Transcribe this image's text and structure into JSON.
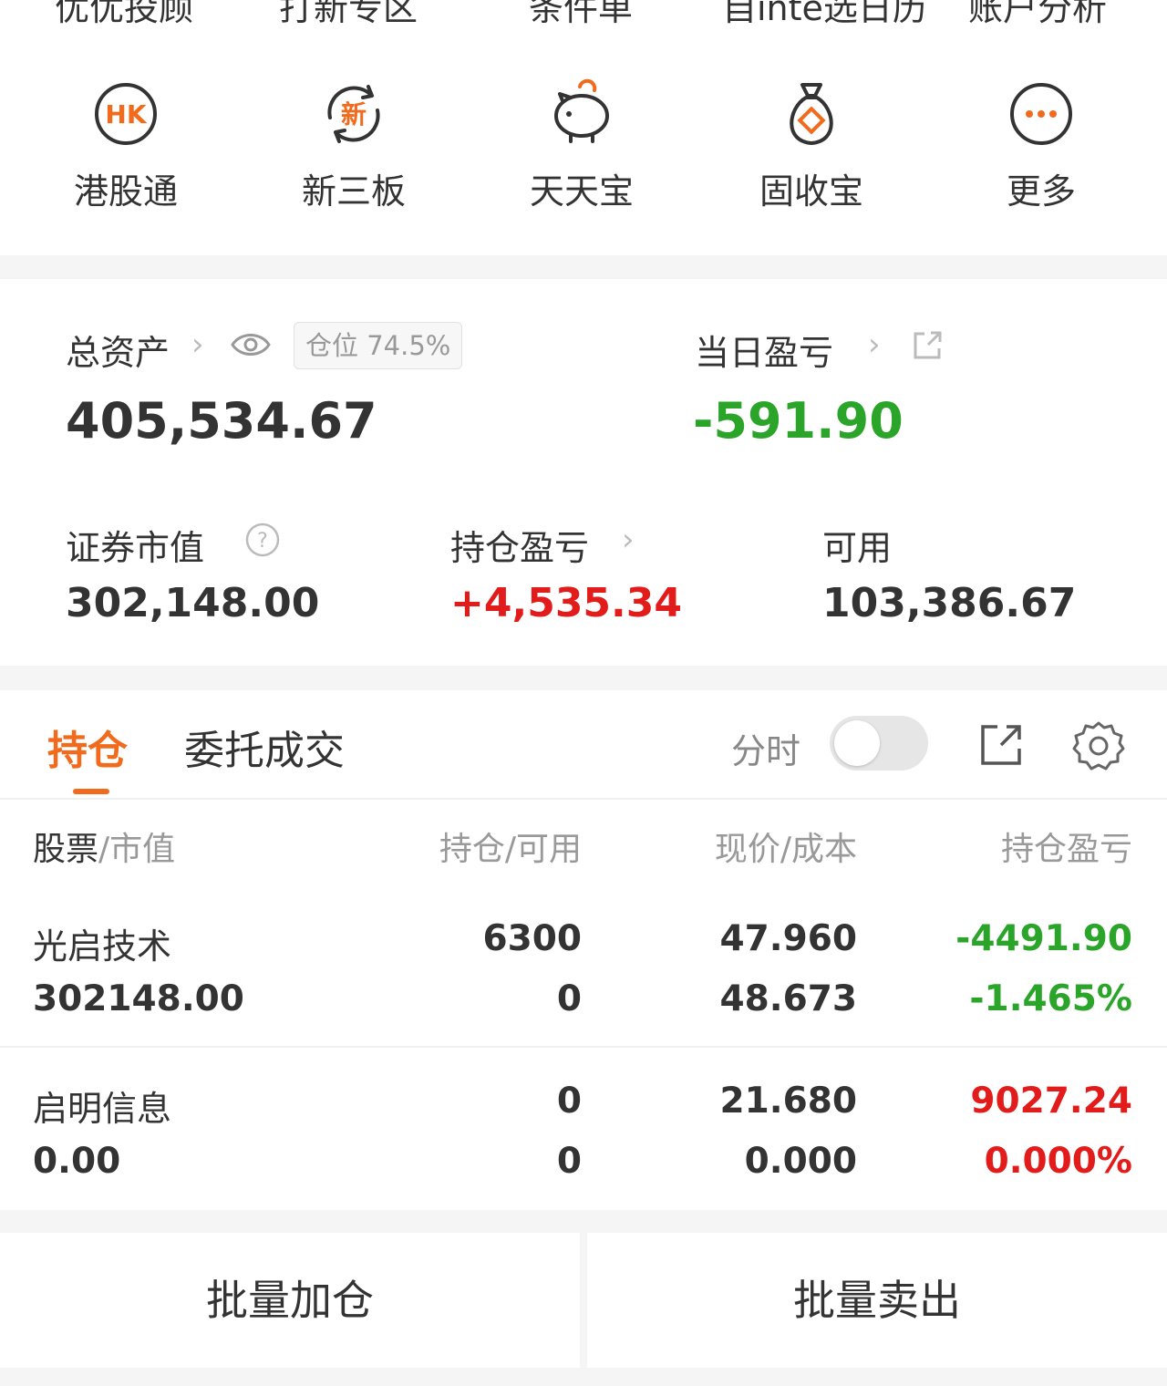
{
  "top_nav": {
    "cut_labels": [
      "优优投顾",
      "打新专区",
      "条件单",
      "自inte选日历",
      "账户分析"
    ],
    "items": [
      {
        "label": "港股通",
        "icon": "hk-icon",
        "icon_text": "HK"
      },
      {
        "label": "新三板",
        "icon": "new-board-icon",
        "icon_text": "新"
      },
      {
        "label": "天天宝",
        "icon": "piggy-bank-icon"
      },
      {
        "label": "固收宝",
        "icon": "money-bag-icon"
      },
      {
        "label": "更多",
        "icon": "more-icon"
      }
    ]
  },
  "summary": {
    "total_assets_label": "总资产",
    "position_badge": "仓位 74.5%",
    "total_assets_value": "405,534.67",
    "daily_pl_label": "当日盈亏",
    "daily_pl_value": "-591.90",
    "market_value_label": "证券市值",
    "market_value": "302,148.00",
    "holding_pl_label": "持仓盈亏",
    "holding_pl_value": "+4,535.34",
    "available_label": "可用",
    "available_value": "103,386.67"
  },
  "holdings": {
    "tabs": [
      "持仓",
      "委托成交"
    ],
    "toggle_label": "分时",
    "headers": {
      "stock": "股票",
      "sep": "/",
      "market": "市值",
      "position": "持仓/可用",
      "price": "现价/成本",
      "pl": "持仓盈亏"
    },
    "rows": [
      {
        "name": "光启技术",
        "market_value": "302148.00",
        "position": "6300",
        "available": "0",
        "price": "47.960",
        "cost": "48.673",
        "pl": "-4491.90",
        "pl_pct": "-1.465%",
        "color": "#2aa52a"
      },
      {
        "name": "启明信息",
        "market_value": "0.00",
        "position": "0",
        "available": "0",
        "price": "21.680",
        "cost": "0.000",
        "pl": "9027.24",
        "pl_pct": "0.000%",
        "color": "#e21b1b"
      }
    ]
  },
  "actions": {
    "batch_add": "批量加仓",
    "batch_sell": "批量卖出"
  },
  "colors": {
    "accent": "#f26a1c",
    "gain": "#e21b1b",
    "loss": "#2aa52a"
  }
}
